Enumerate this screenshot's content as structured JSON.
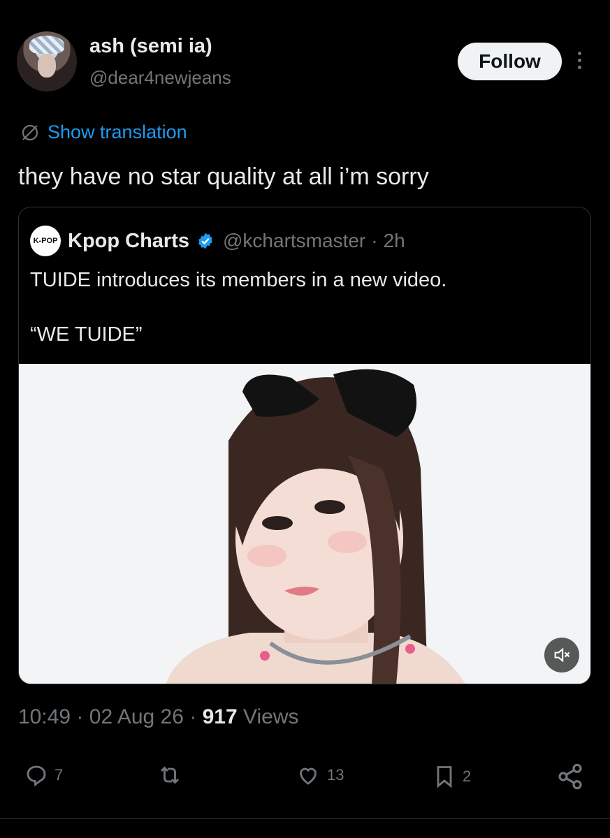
{
  "author": {
    "name": "ash (semi ia)",
    "handle": "@dear4newjeans",
    "follow_label": "Follow"
  },
  "translation_label": "Show translation",
  "tweet_text": "they have no star quality at all i’m sorry",
  "quote": {
    "logo_text": "K-POP",
    "name": "Kpop Charts",
    "handle": "@kchartsmaster",
    "separator": "·",
    "time": "2h",
    "text_line1": "TUIDE introduces its members in a new video.",
    "text_line2": "“WE TUIDE”"
  },
  "meta": {
    "time": "10:49",
    "date": "02 Aug 26",
    "views_count": "917",
    "views_label": "Views",
    "separator": "·"
  },
  "actions": {
    "replies": "7",
    "reposts": "",
    "likes": "13",
    "bookmarks": "2"
  },
  "colors": {
    "background": "#000000",
    "link": "#1d9bf0",
    "muted": "#71767b",
    "text": "#e7e9ea",
    "verified": "#1d9bf0"
  }
}
